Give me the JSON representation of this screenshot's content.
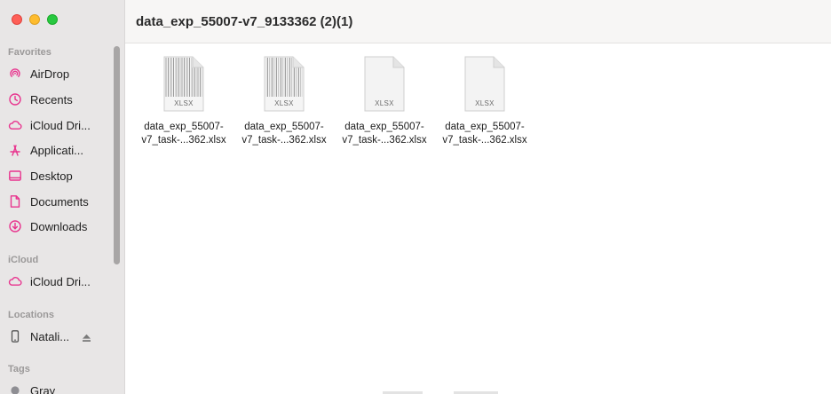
{
  "window": {
    "title": "data_exp_55007-v7_9133362 (2)(1)"
  },
  "sidebar": {
    "sections": {
      "favorites": "Favorites",
      "icloud": "iCloud",
      "locations": "Locations",
      "tags": "Tags"
    },
    "favorites": [
      {
        "label": "AirDrop",
        "icon": "airdrop-icon"
      },
      {
        "label": "Recents",
        "icon": "clock-icon"
      },
      {
        "label": "iCloud Dri...",
        "icon": "cloud-icon"
      },
      {
        "label": "Applicati...",
        "icon": "applications-icon"
      },
      {
        "label": "Desktop",
        "icon": "desktop-icon"
      },
      {
        "label": "Documents",
        "icon": "document-icon"
      },
      {
        "label": "Downloads",
        "icon": "download-icon"
      }
    ],
    "icloud": [
      {
        "label": "iCloud Dri...",
        "icon": "cloud-icon"
      }
    ],
    "locations": [
      {
        "label": "Natali...",
        "icon": "phone-icon"
      }
    ],
    "tags": [
      {
        "label": "Gray",
        "color": "#8e8e93"
      }
    ],
    "accent_color": "#e8348e"
  },
  "files": [
    {
      "name_line1": "data_exp_55007-",
      "name_line2": "v7_task-...362.xlsx",
      "ext": "XLSX",
      "preview": "striped"
    },
    {
      "name_line1": "data_exp_55007-",
      "name_line2": "v7_task-...362.xlsx",
      "ext": "XLSX",
      "preview": "striped"
    },
    {
      "name_line1": "data_exp_55007-",
      "name_line2": "v7_task-...362.xlsx",
      "ext": "XLSX",
      "preview": "plain"
    },
    {
      "name_line1": "data_exp_55007-",
      "name_line2": "v7_task-...362.xlsx",
      "ext": "XLSX",
      "preview": "plain"
    }
  ]
}
